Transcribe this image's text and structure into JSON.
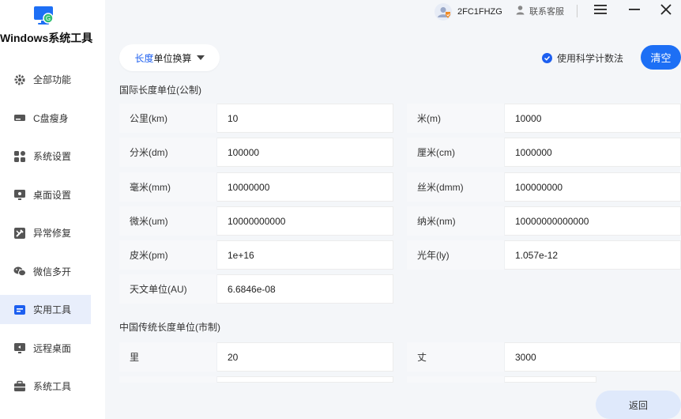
{
  "app": {
    "title": "Windows系统工具"
  },
  "sidebar": {
    "items": [
      {
        "label": "全部功能",
        "icon": "gear-icon"
      },
      {
        "label": "C盘瘦身",
        "icon": "disk-icon"
      },
      {
        "label": "系统设置",
        "icon": "grid-icon"
      },
      {
        "label": "桌面设置",
        "icon": "monitor-icon"
      },
      {
        "label": "异常修复",
        "icon": "wrench-icon"
      },
      {
        "label": "微信多开",
        "icon": "wechat-icon"
      },
      {
        "label": "实用工具",
        "icon": "toolbox-icon",
        "active": true
      },
      {
        "label": "远程桌面",
        "icon": "remote-desktop-icon"
      },
      {
        "label": "系统工具",
        "icon": "briefcase-icon"
      }
    ]
  },
  "topbar": {
    "user_name": "2FC1FHZG",
    "support_label": "联系客服"
  },
  "toolbar": {
    "dropdown_prefix": "长度",
    "dropdown_rest": "单位换算",
    "sci_label": "使用科学计数法",
    "clear_label": "清空",
    "back_label": "返回"
  },
  "metric": {
    "title": "国际长度单位(公制)",
    "rows": [
      {
        "label": "公里(km)",
        "value": "10"
      },
      {
        "label": "米(m)",
        "value": "10000"
      },
      {
        "label": "分米(dm)",
        "value": "100000"
      },
      {
        "label": "厘米(cm)",
        "value": "1000000"
      },
      {
        "label": "毫米(mm)",
        "value": "10000000"
      },
      {
        "label": "丝米(dmm)",
        "value": "100000000"
      },
      {
        "label": "微米(um)",
        "value": "10000000000"
      },
      {
        "label": "纳米(nm)",
        "value": "10000000000000"
      },
      {
        "label": "皮米(pm)",
        "value": "1e+16"
      },
      {
        "label": "光年(ly)",
        "value": "1.057e-12"
      },
      {
        "label": "天文单位(AU)",
        "value": "6.6846e-08"
      }
    ]
  },
  "chinese": {
    "title": "中国传统长度单位(市制)",
    "rows": [
      {
        "label": "里",
        "value": "20"
      },
      {
        "label": "丈",
        "value": "3000"
      }
    ]
  },
  "colors": {
    "accent": "#1d6ff5",
    "active_bg": "#e8eefb"
  }
}
